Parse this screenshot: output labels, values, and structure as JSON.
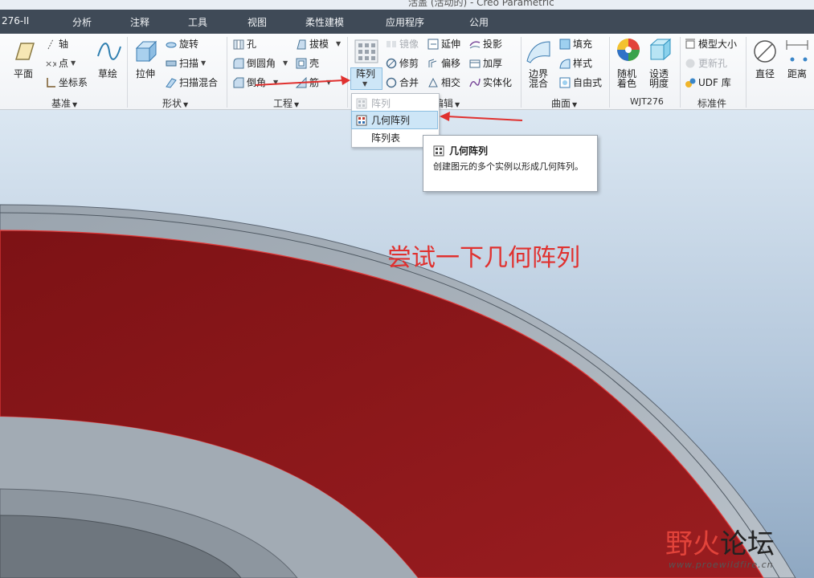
{
  "titlebar": {
    "text": "活盖 (活动的) - Creo Parametric"
  },
  "menu": [
    "276-II",
    "分析",
    "注释",
    "工具",
    "视图",
    "柔性建模",
    "应用程序",
    "公用"
  ],
  "ribbon": {
    "datum": {
      "plane": "平面",
      "axis": "轴",
      "point": "点",
      "csys": "坐标系",
      "sketch": "草绘",
      "group": "基准"
    },
    "shapes": {
      "extrude": "拉伸",
      "revolve": "旋转",
      "sweep": "扫描",
      "swept_blend": "扫描混合",
      "group": "形状"
    },
    "engineering": {
      "hole": "孔",
      "round": "倒圆角",
      "chamfer": "倒角",
      "draft": "拔模",
      "shell": "壳",
      "rib": "筋",
      "group": "工程"
    },
    "editing": {
      "pattern": "阵列",
      "mirror": "镜像",
      "trim": "修剪",
      "merge": "合并",
      "extend": "延伸",
      "offset": "偏移",
      "intersect": "相交",
      "project": "投影",
      "thicken": "加厚",
      "solidify": "实体化",
      "group": "编辑"
    },
    "surfaces": {
      "boundary_blend": "边界\n混合",
      "fill": "填充",
      "style": "样式",
      "freestyle": "自由式",
      "group": "曲面"
    },
    "wjt": {
      "random_color": "随机\n着色",
      "set_transparency": "设透\n明度",
      "group": "WJT276"
    },
    "standard": {
      "model_size": "模型大小",
      "update_hole": "更新孔",
      "udf": "UDF 库",
      "group": "标准件"
    },
    "measure": {
      "diameter": "直径",
      "distance": "距离"
    }
  },
  "dropdown": {
    "items": [
      "阵列",
      "几何阵列",
      "阵列表"
    ]
  },
  "tooltip": {
    "title": "几何阵列",
    "desc": "创建图元的多个实例以形成几何阵列。"
  },
  "annotation": "尝试一下几何阵列",
  "watermark": {
    "part1": "野火",
    "part2": "论坛",
    "url": "www.proewildfire.cn"
  },
  "colors": {
    "menubar": "#3f4a57",
    "accent_red": "#e0312f",
    "model_red": "#8e1a1d",
    "hover": "#cde6f7"
  }
}
